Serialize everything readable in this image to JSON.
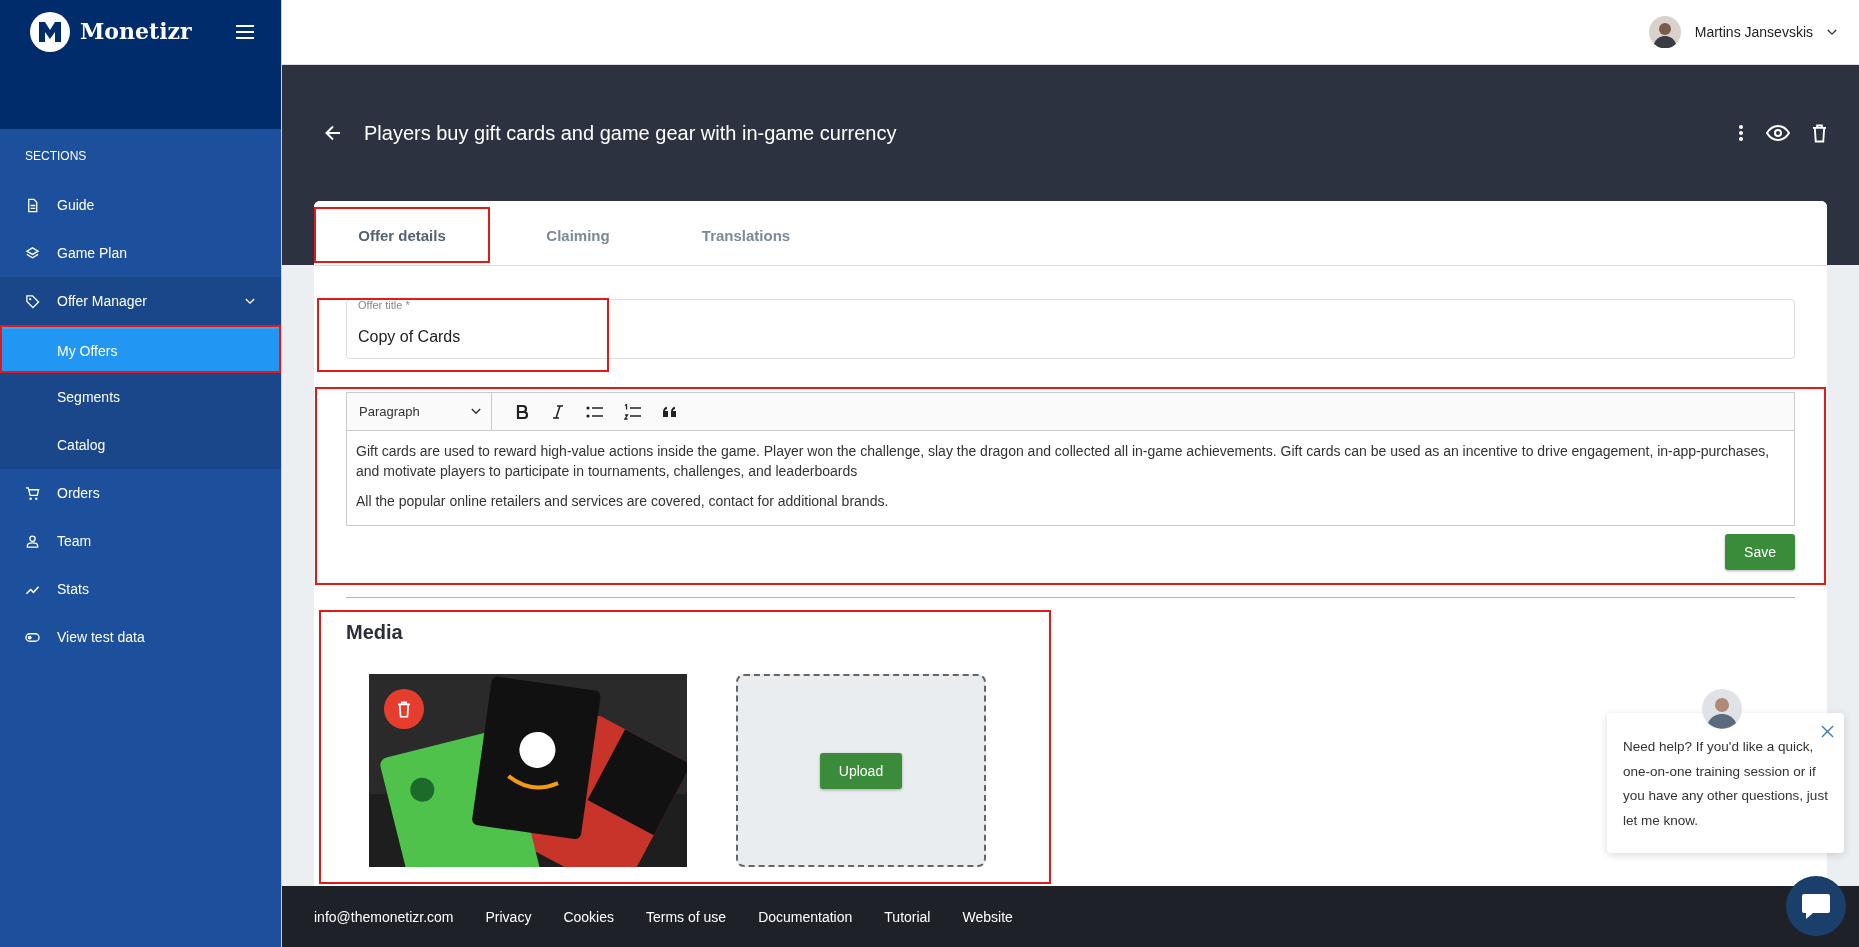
{
  "brand": {
    "name": "Monetizr"
  },
  "sidebar": {
    "section_label": "SECTIONS",
    "items": [
      {
        "label": "Guide",
        "selected": false,
        "highlighted": false
      },
      {
        "label": "Game Plan",
        "selected": false,
        "highlighted": false
      },
      {
        "label": "Offer Manager",
        "selected": false,
        "highlighted": false,
        "expanded": true,
        "children": [
          {
            "label": "My Offers",
            "selected": true,
            "highlighted": true
          },
          {
            "label": "Segments",
            "selected": false,
            "highlighted": false
          },
          {
            "label": "Catalog",
            "selected": false,
            "highlighted": false
          }
        ]
      },
      {
        "label": "Orders",
        "selected": false,
        "highlighted": false
      },
      {
        "label": "Team",
        "selected": false,
        "highlighted": false
      },
      {
        "label": "Stats",
        "selected": false,
        "highlighted": false
      },
      {
        "label": "View test data",
        "selected": false,
        "highlighted": false
      }
    ]
  },
  "user": {
    "name": "Martins Jansevskis"
  },
  "page": {
    "title": "Players buy gift cards and game gear with in-game currency"
  },
  "tabs": [
    {
      "label": "Offer details",
      "selected": true,
      "highlighted": true
    },
    {
      "label": "Claiming",
      "selected": false,
      "highlighted": false
    },
    {
      "label": "Translations",
      "selected": false,
      "highlighted": false
    }
  ],
  "offer_title_field": {
    "label": "Offer title *",
    "value": "Copy of Cards",
    "highlighted": true
  },
  "editor": {
    "block_format": "Paragraph",
    "highlighted": true,
    "paragraphs": [
      "Gift cards are used to reward high-value actions inside the game. Player won the challenge, slay the dragon and collected all in-game achievements. Gift cards can be used as an incentive to drive engagement, in-app-purchases, and motivate players to participate in tournaments, challenges, and leaderboards",
      "All the popular online retailers and services are covered, contact for additional brands."
    ],
    "save_button": "Save"
  },
  "media": {
    "heading": "Media",
    "highlighted": true,
    "upload_button": "Upload"
  },
  "chat": {
    "message": "Need help? If you'd like a quick, one-on-one training session or if you have any other questions, just let me know."
  },
  "footer": {
    "links": [
      "info@themonetizr.com",
      "Privacy",
      "Cookies",
      "Terms of use",
      "Documentation",
      "Tutorial",
      "Website"
    ]
  }
}
